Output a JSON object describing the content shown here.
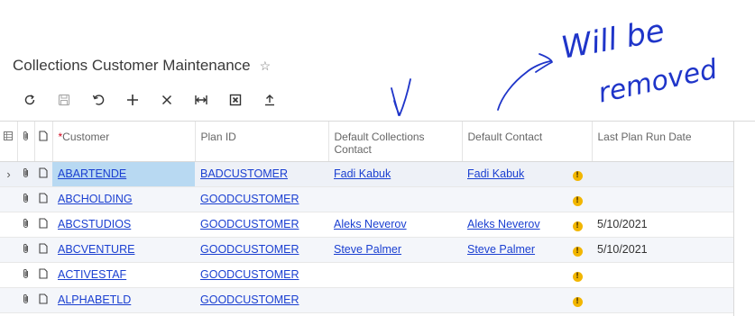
{
  "page": {
    "title": "Collections Customer Maintenance",
    "favorite_icon": "star-outline-icon"
  },
  "toolbar": {
    "buttons": [
      {
        "name": "refresh",
        "icon": "refresh-icon"
      },
      {
        "name": "save",
        "icon": "save-icon"
      },
      {
        "name": "undo",
        "icon": "undo-icon"
      },
      {
        "name": "add",
        "icon": "plus-icon"
      },
      {
        "name": "delete",
        "icon": "close-icon"
      },
      {
        "name": "fit-columns",
        "icon": "fit-width-icon"
      },
      {
        "name": "export-excel",
        "icon": "excel-icon"
      },
      {
        "name": "upload",
        "icon": "upload-icon"
      }
    ]
  },
  "grid": {
    "columns": {
      "customer": "Customer",
      "customer_required_mark": "*",
      "plan_id": "Plan ID",
      "default_collections_contact": "Default Collections Contact",
      "default_contact": "Default Contact",
      "last_plan_run_date": "Last Plan Run Date"
    },
    "rows": [
      {
        "customer": "ABARTENDE",
        "plan_id": "BADCUSTOMER",
        "collections_contact": "Fadi Kabuk",
        "default_contact": "Fadi Kabuk",
        "last_run": "",
        "selected": true
      },
      {
        "customer": "ABCHOLDING",
        "plan_id": "GOODCUSTOMER",
        "collections_contact": "",
        "default_contact": "",
        "last_run": ""
      },
      {
        "customer": "ABCSTUDIOS",
        "plan_id": "GOODCUSTOMER",
        "collections_contact": "Aleks Neverov",
        "default_contact": "Aleks Neverov",
        "last_run": "5/10/2021"
      },
      {
        "customer": "ABCVENTURE",
        "plan_id": "GOODCUSTOMER",
        "collections_contact": "Steve Palmer",
        "default_contact": "Steve Palmer",
        "last_run": "5/10/2021"
      },
      {
        "customer": "ACTIVESTAF",
        "plan_id": "GOODCUSTOMER",
        "collections_contact": "",
        "default_contact": "",
        "last_run": ""
      },
      {
        "customer": "ALPHABETLD",
        "plan_id": "GOODCUSTOMER",
        "collections_contact": "",
        "default_contact": "",
        "last_run": ""
      }
    ]
  },
  "annotation": {
    "line1": "Will be",
    "line2": "removed",
    "color": "#1f35c9"
  },
  "colors": {
    "link": "#1a3fd1",
    "selected_cell": "#b8d9f2",
    "warning": "#f2b600",
    "required": "#d0021b"
  }
}
